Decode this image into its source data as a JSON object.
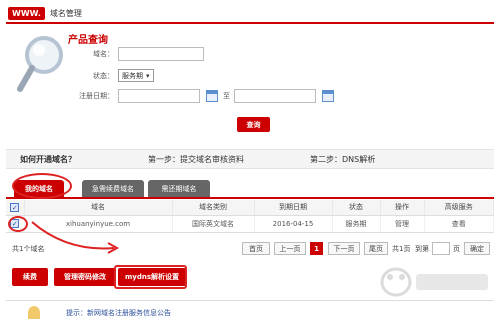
{
  "header": {
    "badge": "WWW.",
    "title": "域名管理"
  },
  "query": {
    "title": "产品查询",
    "domain_label": "域名：",
    "status_label": "状态：",
    "status_value": "服务期",
    "reg_date_label": "注册日期：",
    "to_label": "至",
    "button": "查询"
  },
  "steps": {
    "question": "如何开通域名？",
    "step1": "第一步：提交域名审核资料",
    "step2": "第二步：DNS解析"
  },
  "tabs": [
    {
      "label": "我的域名",
      "active": true
    },
    {
      "label": "急需续费域名",
      "active": false
    },
    {
      "label": "需还期域名",
      "active": false
    }
  ],
  "table": {
    "headers": [
      "域名",
      "域名类别",
      "到期日期",
      "状态",
      "操作",
      "高级服务"
    ],
    "rows": [
      {
        "checked": true,
        "domain": "xihuanyinyue.com",
        "type": "国际英文域名",
        "expiry": "2016-04-15",
        "status": "服务期",
        "op": "管理",
        "adv": "查看"
      }
    ]
  },
  "pager": {
    "total": "共1个域名",
    "first": "首页",
    "prev": "上一页",
    "current": "1",
    "next": "下一页",
    "last": "尾页",
    "pages": "共1页",
    "goto": "到第",
    "page_suffix": "页",
    "confirm": "确定"
  },
  "actions": [
    "续费",
    "管理密码修改",
    "mydns解析设置"
  ],
  "notice": {
    "text": "提示：新网域名注册服务信息公告"
  },
  "colors": {
    "brand_red": "#cc0000",
    "annotation_red": "#dd2222",
    "tab_gray": "#666666"
  }
}
